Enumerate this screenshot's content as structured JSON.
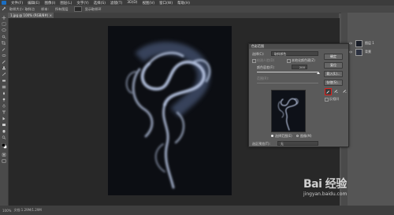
{
  "menu": {
    "logo_label": "Ps",
    "items": [
      "文件(F)",
      "编辑(E)",
      "图像(I)",
      "图层(L)",
      "文字(Y)",
      "选择(S)",
      "滤镜(T)",
      "3D(D)",
      "视图(V)",
      "窗口(W)",
      "帮助(H)"
    ]
  },
  "options_bar": {
    "items": [
      "取样大小: 取样点",
      "样本:",
      "所有图层",
      "显示取样环"
    ]
  },
  "document_tab": {
    "title": "1.jpg @ 100% (RGB/8#)",
    "close": "×"
  },
  "layers": [
    {
      "name": "图层 1",
      "thumb_color": "#1a1e28"
    },
    {
      "name": "背景",
      "thumb_color": "#2c3140"
    }
  ],
  "dialog": {
    "title": "色彩范围",
    "select_label": "选择(C):",
    "select_value": "取样颜色",
    "detect_faces_label": "检测人脸(D)",
    "localized_label": "本地化颜色簇(Z)",
    "fuzziness_label": "颜色容差(F):",
    "fuzziness_value": "200",
    "range_label": "范围(R):",
    "radio_selection": "选择范围(E)",
    "radio_image": "图像(M)",
    "selection_preview_label": "选区预览(T):",
    "selection_preview_value": "无",
    "buttons": {
      "ok": "确定",
      "cancel": "复位",
      "load": "载入(L)...",
      "save": "存储(S)..."
    },
    "invert_label": "反相(I)"
  },
  "status_bar": {
    "zoom": "100%",
    "doc_info": "文档:1.29M/1.29M"
  },
  "watermark": {
    "brand": "Bai 经验",
    "url": "jingyan.baidu.com"
  },
  "colors": {
    "ps_blue": "#1b6ec2",
    "highlight_red": "#e0201c",
    "smoke": "#b9c7e4"
  }
}
